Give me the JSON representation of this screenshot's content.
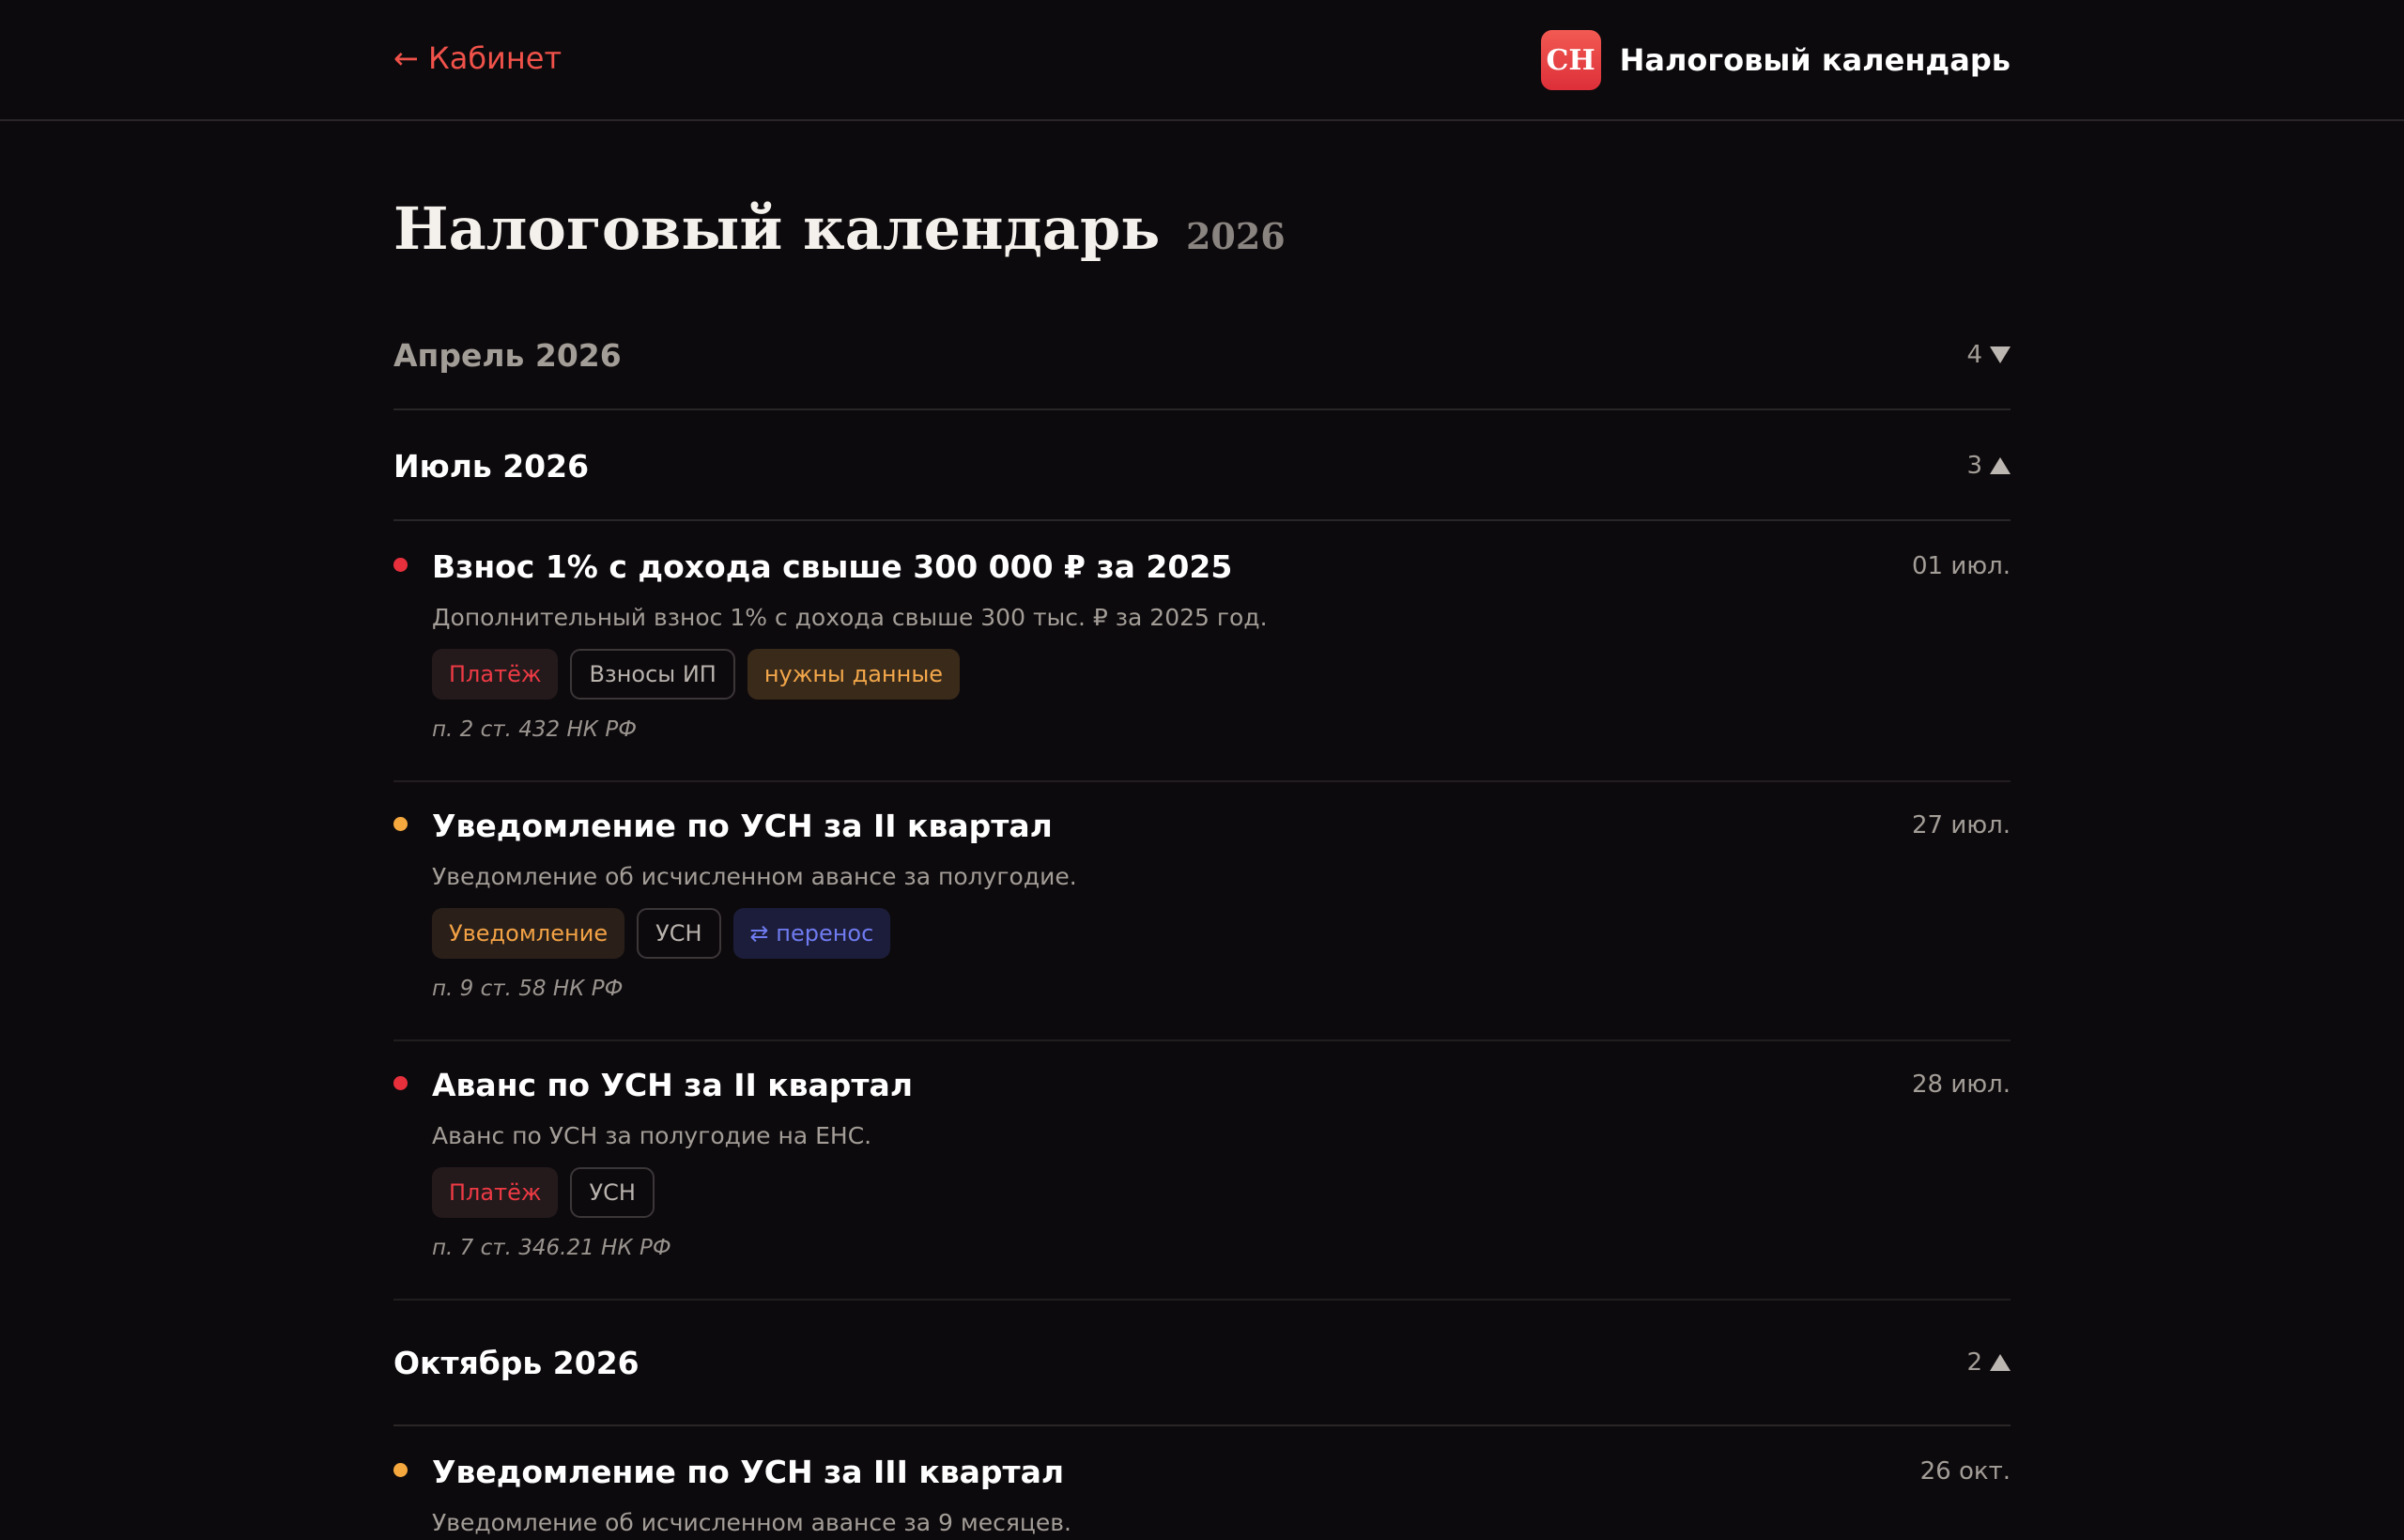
{
  "header": {
    "back_label": "← Кабинет",
    "logo_text": "СН",
    "brand_title": "Налоговый календарь"
  },
  "page": {
    "title": "Налоговый календарь",
    "year": "2026"
  },
  "months": [
    {
      "name": "Апрель 2026",
      "count": "4",
      "state": "collapsed"
    },
    {
      "name": "Июль 2026",
      "count": "3",
      "state": "expanded"
    },
    {
      "name": "Октябрь 2026",
      "count": "2",
      "state": "expanded"
    }
  ],
  "events": [
    {
      "title": "Взнос 1% с дохода свыше 300 000 ₽ за 2025",
      "date": "01 июл.",
      "description": "Дополнительный взнос 1% с дохода свыше 300 тыс. ₽ за 2025 год.",
      "dot_color": "#e8303c",
      "tags": [
        "Платёж",
        "Взносы ИП",
        "нужны данные"
      ],
      "law": "п. 2 ст. 432 НК РФ"
    },
    {
      "title": "Уведомление по УСН за II квартал",
      "date": "27 июл.",
      "description": "Уведомление об исчисленном авансе за полугодие.",
      "dot_color": "#f5a83e",
      "tags": [
        "Уведомление",
        "УСН",
        "⇄ перенос"
      ],
      "law": "п. 9 ст. 58 НК РФ"
    },
    {
      "title": "Аванс по УСН за II квартал",
      "date": "28 июл.",
      "description": "Аванс по УСН за полугодие на ЕНС.",
      "dot_color": "#e8303c",
      "tags": [
        "Платёж",
        "УСН"
      ],
      "law": "п. 7 ст. 346.21 НК РФ"
    },
    {
      "title": "Уведомление по УСН за III квартал",
      "date": "26 окт.",
      "description": "Уведомление об исчисленном авансе за 9 месяцев.",
      "dot_color": "#f5a83e"
    }
  ],
  "colors": {
    "background": "#0d0a0d",
    "accent": "#f0524a",
    "payment": "#e8303c",
    "notification": "#f5a83e",
    "move": "#6f7bf0"
  },
  "icons": {
    "collapsed_indicator": "triangle-down-icon",
    "expanded_indicator": "triangle-up-icon",
    "status_dot": "status-dot-icon"
  }
}
